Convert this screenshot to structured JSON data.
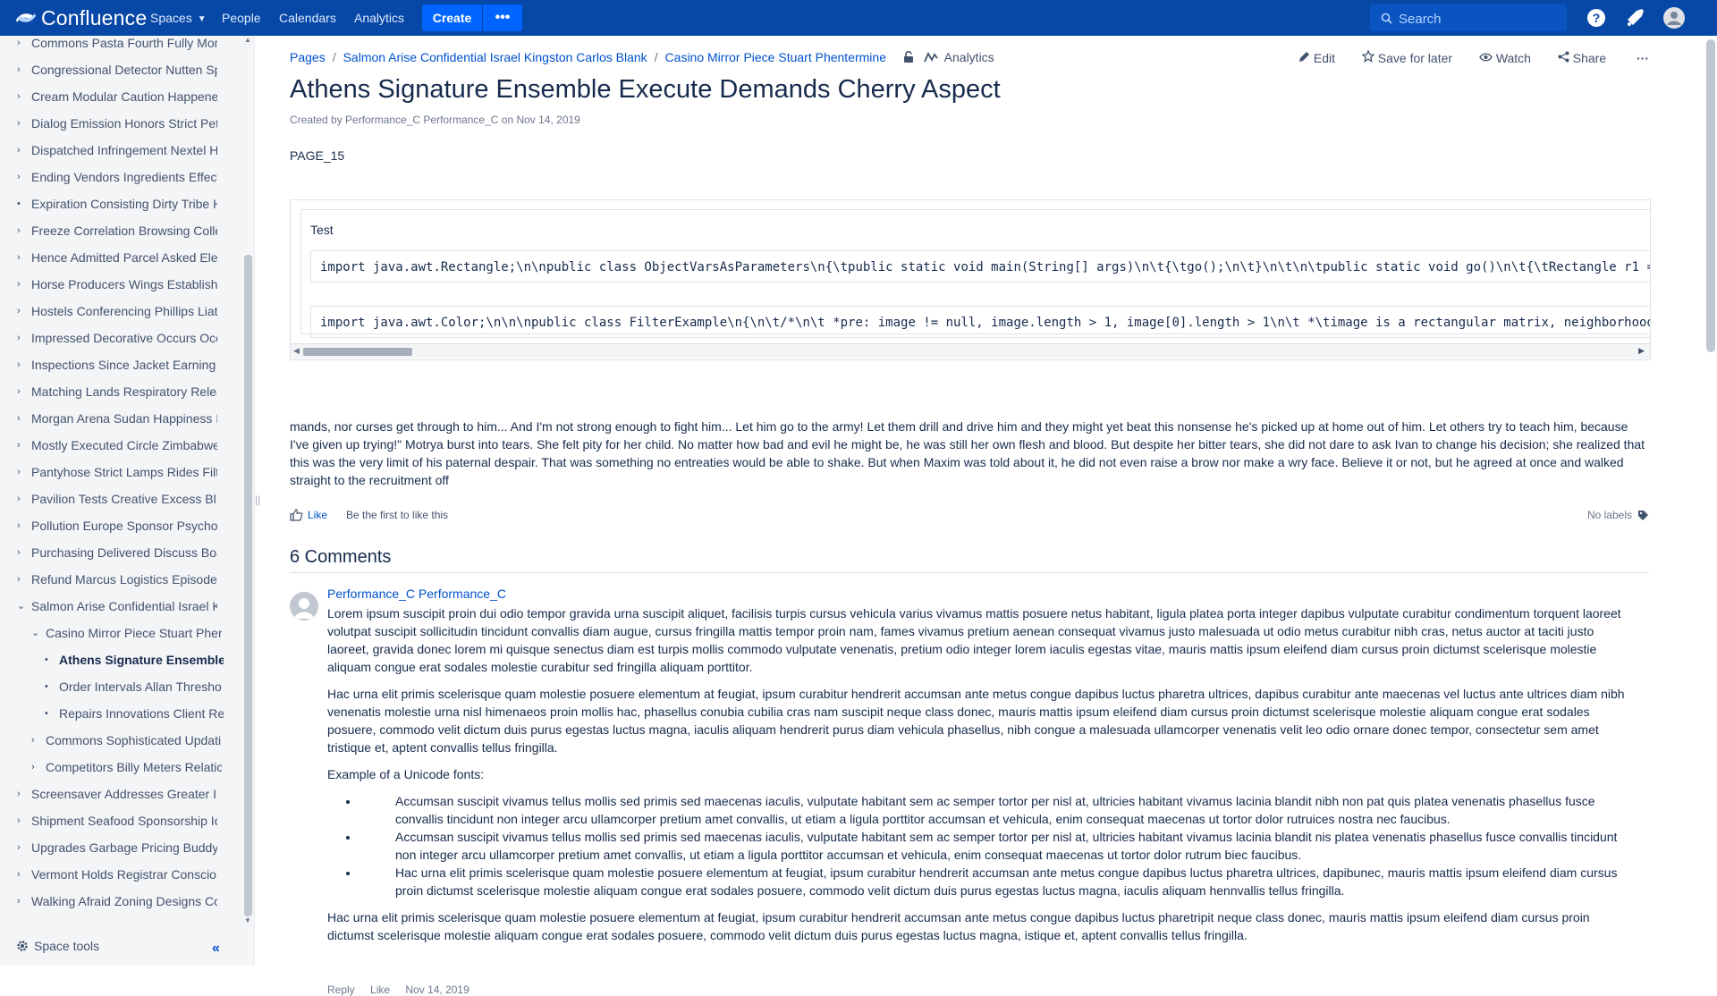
{
  "nav": {
    "brand": "Confluence",
    "spaces": "Spaces",
    "people": "People",
    "calendars": "Calendars",
    "analytics": "Analytics",
    "create": "Create",
    "more": "•••",
    "search_placeholder": "Search"
  },
  "sidebar": {
    "items": [
      {
        "label": "Commons Pasta Fourth Fully Mor",
        "twisty": "›",
        "level": 0
      },
      {
        "label": "Congressional Detector Nutten Sp",
        "twisty": "›",
        "level": 0
      },
      {
        "label": "Cream Modular Caution Happene",
        "twisty": "›",
        "level": 0
      },
      {
        "label": "Dialog Emission Honors Strict Pet",
        "twisty": "›",
        "level": 0
      },
      {
        "label": "Dispatched Infringement Nextel H",
        "twisty": "›",
        "level": 0
      },
      {
        "label": "Ending Vendors Ingredients Effect",
        "twisty": "›",
        "level": 0
      },
      {
        "label": "Expiration Consisting Dirty Tribe H",
        "twisty": "•",
        "level": 0
      },
      {
        "label": "Freeze Correlation Browsing Colle",
        "twisty": "›",
        "level": 0
      },
      {
        "label": "Hence Admitted Parcel Asked Ele",
        "twisty": "›",
        "level": 0
      },
      {
        "label": "Horse Producers Wings Establish",
        "twisty": "›",
        "level": 0
      },
      {
        "label": "Hostels Conferencing Phillips Liat",
        "twisty": "›",
        "level": 0
      },
      {
        "label": "Impressed Decorative Occurs Occ",
        "twisty": "›",
        "level": 0
      },
      {
        "label": "Inspections Since Jacket Earning",
        "twisty": "›",
        "level": 0
      },
      {
        "label": "Matching Lands Respiratory Relea",
        "twisty": "›",
        "level": 0
      },
      {
        "label": "Morgan Arena Sudan Happiness I",
        "twisty": "›",
        "level": 0
      },
      {
        "label": "Mostly Executed Circle Zimbabwe",
        "twisty": "›",
        "level": 0
      },
      {
        "label": "Pantyhose Strict Lamps Rides Filt",
        "twisty": "›",
        "level": 0
      },
      {
        "label": "Pavilion Tests Creative Excess Bl",
        "twisty": "›",
        "level": 0
      },
      {
        "label": "Pollution Europe Sponsor Psycho",
        "twisty": "›",
        "level": 0
      },
      {
        "label": "Purchasing Delivered Discuss Boa",
        "twisty": "›",
        "level": 0
      },
      {
        "label": "Refund Marcus Logistics Episode",
        "twisty": "›",
        "level": 0
      },
      {
        "label": "Salmon Arise Confidential Israel K",
        "twisty": "⌄",
        "level": 0
      },
      {
        "label": "Casino Mirror Piece Stuart Pher",
        "twisty": "⌄",
        "level": 1
      },
      {
        "label": "Athens Signature Ensemble",
        "twisty": "•",
        "level": 2,
        "active": true
      },
      {
        "label": "Order Intervals Allan Thresho",
        "twisty": "•",
        "level": 2
      },
      {
        "label": "Repairs Innovations Client Re",
        "twisty": "•",
        "level": 2
      },
      {
        "label": "Commons Sophisticated Updati",
        "twisty": "›",
        "level": 1
      },
      {
        "label": "Competitors Billy Meters Relatic",
        "twisty": "›",
        "level": 1
      },
      {
        "label": "Screensaver Addresses Greater I",
        "twisty": "›",
        "level": 0
      },
      {
        "label": "Shipment Seafood Sponsorship Ic",
        "twisty": "›",
        "level": 0
      },
      {
        "label": "Upgrades Garbage Pricing Buddy",
        "twisty": "›",
        "level": 0
      },
      {
        "label": "Vermont Holds Registrar Conscio",
        "twisty": "›",
        "level": 0
      },
      {
        "label": "Walking Afraid Zoning Designs Cc",
        "twisty": "›",
        "level": 0
      }
    ],
    "space_tools": "Space tools",
    "collapse": "«"
  },
  "breadcrumb": {
    "pages": "Pages",
    "sep": "/",
    "parent": "Salmon Arise Confidential Israel Kingston Carlos Blank",
    "current": "Casino Mirror Piece Stuart Phentermine",
    "analytics": "Analytics"
  },
  "actions": {
    "edit": "Edit",
    "save": "Save for later",
    "watch": "Watch",
    "share": "Share",
    "more": "···"
  },
  "page": {
    "title": "Athens Signature Ensemble Execute Demands Cherry Aspect",
    "byline": "Created by Performance_C Performance_C on Nov 14, 2019",
    "page_id": "PAGE_15",
    "code_title": "Test",
    "code_line_1": "import java.awt.Rectangle;\\n\\npublic class ObjectVarsAsParameters\\n{\\tpublic static void main(String[] args)\\n\\t{\\tgo();\\n\\t}\\n\\t\\n\\tpublic static void go()\\n\\t{\\tRectangle r1 =",
    "code_line_2": "import java.awt.Color;\\n\\n\\npublic class FilterExample\\n{\\n\\t/*\\n\\t *pre: image != null, image.length > 1, image[0].length > 1\\n\\t *\\timage is a rectangular matrix, neighborhood",
    "body": "mands, nor curses get through to him... And I'm not strong enough to fight him... Let him go to the army! Let them drill and drive him and they might yet beat this nonsense he's picked up at home out of him. Let others try to teach him, because I've given up trying!\" Motrya burst into tears. She felt pity for her child. No matter how bad and evil he might be, he was still her own flesh and blood. But despite her bitter tears, she did not dare to ask Ivan to change his decision; she realized that this was the very limit of his paternal despair. That was something no entreaties would be able to shake. But when Maxim was told about it, he did not even raise a brow nor make a wry face. Believe it or not, but he agreed at once and walked straight to the recruitment off",
    "like": "Like",
    "like_text": "Be the first to like this",
    "labels": "No labels"
  },
  "comments": {
    "heading": "6 Comments",
    "author": "Performance_C Performance_C",
    "p1": "Lorem ipsum suscipit proin dui odio tempor gravida urna suscipit aliquet, facilisis turpis cursus vehicula varius vivamus mattis posuere netus habitant, ligula platea porta integer dapibus vulputate curabitur condimentum torquent laoreet volutpat suscipit sollicitudin tincidunt convallis diam augue, cursus fringilla mattis tempor proin nam, fames vivamus pretium aenean consequat vivamus justo malesuada ut odio metus curabitur nibh cras, netus auctor at taciti justo laoreet, gravida donec lorem mi quisque senectus diam est turpis mollis commodo vulputate venenatis, pretium odio integer lorem iaculis egestas vitae, mauris mattis ipsum eleifend diam cursus proin dictumst scelerisque molestie aliquam congue erat sodales molestie curabitur sed fringilla aliquam porttitor.",
    "p2": "Hac urna elit primis scelerisque quam molestie posuere elementum at feugiat, ipsum curabitur hendrerit accumsan ante metus congue dapibus luctus pharetra ultrices, dapibus curabitur ante maecenas vel luctus ante ultrices diam nibh venenatis molestie urna nisl himenaeos proin mollis hac, phasellus conubia cubilia cras nam suscipit neque class donec, mauris mattis ipsum eleifend diam cursus proin dictumst scelerisque molestie aliquam congue erat sodales posuere, commodo velit dictum duis purus egestas luctus magna, iaculis aliquam hendrerit purus diam vehicula phasellus, nibh congue a malesuada ullamcorper venenatis velit leo odio ornare donec tempor, consectetur sem amet tristique et, aptent convallis tellus fringilla.",
    "unicode": "Example of a Unicode fonts:",
    "li1": "Accumsan suscipit vivamus tellus mollis sed primis sed maecenas iaculis, vulputate habitant sem ac semper tortor per nisl at, ultricies habitant vivamus lacinia blandit nibh non pat quis platea venenatis phasellus fusce convallis tincidunt non integer arcu ullamcorper pretium amet convallis, ut etiam a ligula porttitor accumsan et vehicula, enim consequat maecenas ut tortor dolor rutruices nostra nec faucibus.",
    "li2": "Accumsan suscipit vivamus tellus mollis sed primis sed maecenas iaculis, vulputate habitant sem ac semper tortor per nisl at, ultricies habitant vivamus lacinia blandit nis platea venenatis phasellus fusce convallis tincidunt non integer arcu ullamcorper pretium amet convallis, ut etiam a ligula porttitor accumsan et vehicula, enim consequat maecenas ut tortor dolor rutrum biec faucibus.",
    "li3": "Hac urna elit primis scelerisque quam molestie posuere elementum at feugiat, ipsum curabitur hendrerit accumsan ante metus congue dapibus luctus pharetra ultrices, dapibunec, mauris mattis ipsum eleifend diam cursus proin dictumst scelerisque molestie aliquam congue erat sodales posuere, commodo velit dictum duis purus egestas luctus magna, iaculis aliquam hennvallis tellus fringilla.",
    "p3": "Hac urna elit primis scelerisque quam molestie posuere elementum at feugiat, ipsum curabitur hendrerit accumsan ante metus congue dapibus luctus pharetripit neque class donec, mauris mattis ipsum eleifend diam cursus proin dictumst scelerisque molestie aliquam congue erat sodales posuere, commodo velit dictum duis purus egestas luctus magna, istique et, aptent convallis tellus fringilla.",
    "reply": "Reply",
    "like": "Like",
    "date": "Nov 14, 2019"
  },
  "colors": {
    "nav_bg": "#0747a6",
    "create_bg": "#0065ff",
    "link": "#0052cc",
    "sidebar_bg": "#f4f5f7"
  }
}
